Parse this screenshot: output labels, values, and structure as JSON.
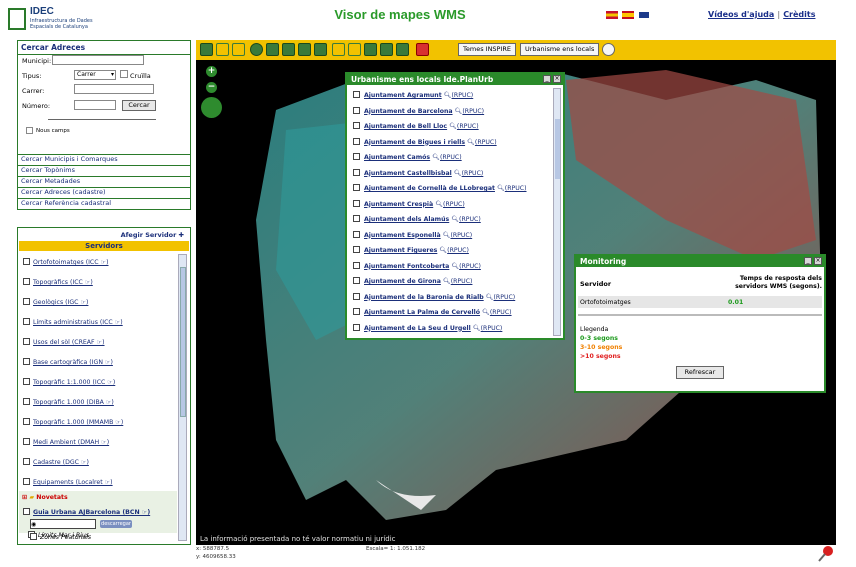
{
  "header": {
    "logo_title": "IDEC",
    "logo_line1": "Infraestructura de Dades",
    "logo_line2": "Espacials de Catalunya",
    "app_title": "Visor de mapes WMS",
    "help_link": "Vídeos d'ajuda",
    "credits_link": "Crèdits"
  },
  "search": {
    "title": "Cercar Adreces",
    "municipi_label": "Municipi:",
    "tipus_label": "Tipus:",
    "tipus_value": "Carrer",
    "cruilla_label": "Cruïlla",
    "carrer_label": "Carrer:",
    "numero_label": "Número:",
    "cercar_button": "Cercar",
    "nous_camps_label": "Nous camps",
    "links": [
      "Cercar Municipis i Comarques",
      "Cercar Topònims",
      "Cercar Metadades",
      "Cercar Adreces (cadastre)",
      "Cercar Referència cadastral"
    ]
  },
  "servers": {
    "add_label": "Afegir Servidor",
    "title": "Servidors",
    "items": [
      "Ortofotoimatges (ICC ☞)",
      "Topogràfics (ICC ☞)",
      "Geològics (IGC ☞)",
      "Límits administratius (ICC ☞)",
      "Usos del sòl (CREAF ☞)",
      "Base cartogràfica (IGN ☞)",
      "Topogràfic 1:1.000 (ICC ☞)",
      "Topogràfic 1.000 (DIBA ☞)",
      "Topogràfic 1.000 (MMAMB ☞)",
      "Medi Ambient (DMAH ☞)",
      "Cadastre (DGC ☞)",
      "Equipaments (Localret ☞)"
    ],
    "novetats_label": "Novetats",
    "guia_label": "Guia Urbana AJBarcelona (BCN ☞)",
    "guia_subbutton": "descarregar",
    "sub_items": [
      "Límits Mar i Rius",
      "Zones Peatonals"
    ]
  },
  "toolbar": {
    "inspire_button": "Temes INSPIRE",
    "urbanisme_button": "Urbanisme ens locals"
  },
  "urbanisme_dialog": {
    "title": "Urbanisme ens locals Ide.PlanUrb",
    "rpuc_label": "(RPUC)",
    "items": [
      "Ajuntament Agramunt",
      "Ajuntament de Barcelona",
      "Ajuntament de Bell Lloc",
      "Ajuntament de Bigues i riells",
      "Ajuntament Camós",
      "Ajuntament Castellbisbal",
      "Ajuntament de Cornellà de LLobregat",
      "Ajuntament Crespià",
      "Ajuntament dels Alamús",
      "Ajuntament Esponellà",
      "Ajuntament Figueres",
      "Ajuntament Fontcoberta",
      "Ajuntament de Girona",
      "Ajuntament de la Baronia de Rialb",
      "Ajuntament La Palma de Cervelló",
      "Ajuntament de La Seu d Urgell"
    ]
  },
  "monitoring": {
    "title": "Monitoring",
    "col_server": "Servidor",
    "col_time": "Temps de resposta dels servidors WMS (segons).",
    "row_name": "Ortofotoimatges",
    "row_value": "0.01",
    "legend_title": "Llegenda",
    "legend_green": "0-3 segons",
    "legend_orange": "3-10 segons",
    "legend_red": ">10 segons",
    "refresh_button": "Refrescar",
    "colors": {
      "green": "#1c9a1c",
      "orange": "#f08000",
      "red": "#e02020"
    }
  },
  "map": {
    "disclaimer": "La informació presentada no té valor normatiu ni jurídic"
  },
  "status": {
    "x": "x: 588787.5",
    "y": "y: 4609658.33",
    "scale": "Escala= 1: 1.051.182"
  },
  "colors": {
    "accent_green": "#2a8a2a",
    "toolbar_yellow": "#f2c200",
    "link_blue": "#1b2f7a"
  }
}
